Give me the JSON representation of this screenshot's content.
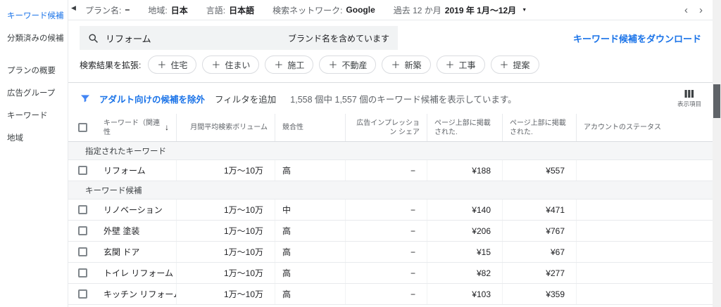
{
  "colors": {
    "accent": "#1a73e8",
    "text": "#202124",
    "muted": "#5f6368"
  },
  "sidebar": {
    "items": [
      {
        "label": "キーワード候補",
        "active": true
      },
      {
        "label": "分類済みの候補",
        "active": false
      },
      {
        "label": "プランの概要",
        "active": false
      },
      {
        "label": "広告グループ",
        "active": false
      },
      {
        "label": "キーワード",
        "active": false
      },
      {
        "label": "地域",
        "active": false
      }
    ]
  },
  "topbar": {
    "plan_label": "プラン名:",
    "plan_value": "−",
    "location_label": "地域:",
    "location_value": "日本",
    "language_label": "言語:",
    "language_value": "日本語",
    "network_label": "検索ネットワーク:",
    "network_value": "Google",
    "period_label": "過去 12 か月",
    "period_value": "2019 年 1月〜12月"
  },
  "search": {
    "query": "リフォーム",
    "brand_note": "ブランド名を含めています",
    "download_link": "キーワード候補をダウンロード"
  },
  "expand": {
    "label": "検索結果を拡張:",
    "chips": [
      "住宅",
      "住まい",
      "施工",
      "不動産",
      "新築",
      "工事",
      "提案"
    ]
  },
  "filterbar": {
    "exclude_link": "アダルト向けの候補を除外",
    "add_filter": "フィルタを追加",
    "count_text": "1,558 個中 1,557 個のキーワード候補を表示しています。",
    "columns_label": "表示項目"
  },
  "table": {
    "headers": [
      "キーワード（関連性",
      "月間平均検索ボリューム",
      "競合性",
      "広告インプレッション シェア",
      "ページ上部に掲載された.",
      "ページ上部に掲載された.",
      "アカウントのステータス"
    ],
    "sections": [
      {
        "title": "指定されたキーワード",
        "rows": [
          {
            "keyword": "リフォーム",
            "volume": "1万〜10万",
            "competition": "高",
            "impression_share": "−",
            "top_low": "¥188",
            "top_high": "¥557",
            "status": ""
          }
        ]
      },
      {
        "title": "キーワード候補",
        "rows": [
          {
            "keyword": "リノベーション",
            "volume": "1万〜10万",
            "competition": "中",
            "impression_share": "−",
            "top_low": "¥140",
            "top_high": "¥471",
            "status": ""
          },
          {
            "keyword": "外壁 塗装",
            "volume": "1万〜10万",
            "competition": "高",
            "impression_share": "−",
            "top_low": "¥206",
            "top_high": "¥767",
            "status": ""
          },
          {
            "keyword": "玄関 ドア",
            "volume": "1万〜10万",
            "competition": "高",
            "impression_share": "−",
            "top_low": "¥15",
            "top_high": "¥67",
            "status": ""
          },
          {
            "keyword": "トイレ リフォーム",
            "volume": "1万〜10万",
            "competition": "高",
            "impression_share": "−",
            "top_low": "¥82",
            "top_high": "¥277",
            "status": ""
          },
          {
            "keyword": "キッチン リフォーム",
            "volume": "1万〜10万",
            "competition": "高",
            "impression_share": "−",
            "top_low": "¥103",
            "top_high": "¥359",
            "status": ""
          }
        ]
      }
    ]
  }
}
